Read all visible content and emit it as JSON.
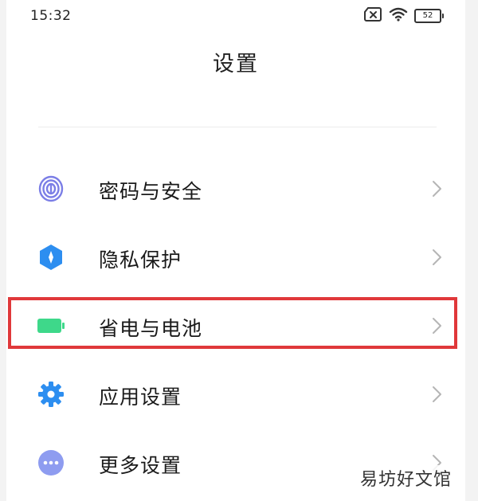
{
  "status_bar": {
    "time": "15:32",
    "battery_level": "52",
    "icons": [
      "sim-off-icon",
      "wifi-icon",
      "battery-icon"
    ]
  },
  "page": {
    "title": "设置"
  },
  "menu": {
    "items": [
      {
        "label": "密码与安全",
        "icon": "fingerprint-icon",
        "icon_color": "#7b7ee6"
      },
      {
        "label": "隐私保护",
        "icon": "privacy-shield-icon",
        "icon_color": "#2d8ef0"
      },
      {
        "label": "省电与电池",
        "icon": "battery-saver-icon",
        "icon_color": "#3ed88a",
        "highlighted": true
      },
      {
        "label": "应用设置",
        "icon": "gear-icon",
        "icon_color": "#2d8ef0"
      },
      {
        "label": "更多设置",
        "icon": "more-dots-icon",
        "icon_color": "#8e9cf0"
      }
    ]
  },
  "annotation": {
    "highlight_color": "#e0383a"
  },
  "watermark": {
    "text": "易坊好文馆"
  }
}
